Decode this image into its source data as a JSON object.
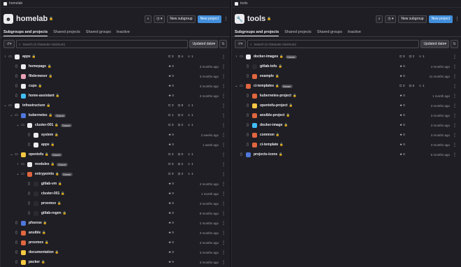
{
  "left": {
    "browser_tab": "homelab",
    "title": "homelab",
    "avatar_glyph": "☻",
    "actions": {
      "new_subgroup": "New subgroup",
      "new_project": "New project"
    },
    "tabs": [
      "Subgroups and projects",
      "Shared projects",
      "Shared groups",
      "Inactive"
    ],
    "search_placeholder": "Search (3 character minimum)",
    "sort_label": "Updated date",
    "rows": [
      {
        "indent": 0,
        "chev": "›",
        "kind": "group",
        "name": "apps",
        "icon_color": "#ececef",
        "stats": [
          "3",
          "4",
          "1"
        ],
        "time": ""
      },
      {
        "indent": 1,
        "chev": "",
        "kind": "project",
        "name": "homepage",
        "icon_color": "#ececef",
        "star": "0",
        "time": "3 months ago"
      },
      {
        "indent": 1,
        "chev": "",
        "kind": "project",
        "name": "filebrowser",
        "icon_color": "#e9a0b6",
        "star": "0",
        "time": "3 months ago"
      },
      {
        "indent": 1,
        "chev": "",
        "kind": "project",
        "name": "cups",
        "icon_color": "#ececef",
        "star": "0",
        "time": "3 months ago"
      },
      {
        "indent": 1,
        "chev": "",
        "kind": "project",
        "name": "home-assistant",
        "icon_color": "#41bdf5",
        "star": "0",
        "time": "3 months ago"
      },
      {
        "indent": 0,
        "chev": "⌄",
        "kind": "group",
        "name": "infrastructure",
        "icon_color": "#ececef",
        "stats": [
          "3",
          "8",
          "1"
        ],
        "time": ""
      },
      {
        "indent": 1,
        "chev": "⌄",
        "kind": "group",
        "name": "kubernetes",
        "badge": "Owner",
        "icon_color": "#4f77dc",
        "stats": [
          "1",
          "2",
          "1"
        ],
        "time": ""
      },
      {
        "indent": 2,
        "chev": "⌄",
        "kind": "group",
        "name": "cluster-001",
        "badge": "Owner",
        "icon_color": "#ececef",
        "stats": [
          "0",
          "2",
          "1"
        ],
        "time": ""
      },
      {
        "indent": 3,
        "chev": "",
        "kind": "project",
        "name": "system",
        "icon_color": "#ececef",
        "star": "0",
        "time": "2 weeks ago"
      },
      {
        "indent": 3,
        "chev": "",
        "kind": "project",
        "name": "apps",
        "icon_color": "#ececef",
        "star": "0",
        "time": "1 week ago"
      },
      {
        "indent": 1,
        "chev": "⌄",
        "kind": "group",
        "name": "opentofu",
        "badge": "Owner",
        "icon_color": "#f5c842",
        "stats": [
          "2",
          "0",
          "1"
        ],
        "time": ""
      },
      {
        "indent": 2,
        "chev": "›",
        "kind": "group",
        "name": "modules",
        "badge": "Owner",
        "icon_color": "#ececef",
        "stats": [
          "0",
          "2",
          "1"
        ],
        "time": ""
      },
      {
        "indent": 2,
        "chev": "⌄",
        "kind": "group",
        "name": "entrypoints",
        "badge": "Owner",
        "icon_color": "#e0663f",
        "stats": [
          "0",
          "4",
          "1"
        ],
        "time": ""
      },
      {
        "indent": 3,
        "chev": "",
        "kind": "project",
        "name": "gitlab-vm",
        "icon_color": "#2b2a30",
        "star": "0",
        "time": "3 months ago"
      },
      {
        "indent": 3,
        "chev": "",
        "kind": "project",
        "name": "cluster-001",
        "icon_color": "#2b2a30",
        "star": "0",
        "time": "1 month ago"
      },
      {
        "indent": 3,
        "chev": "",
        "kind": "project",
        "name": "proxmox",
        "icon_color": "#2b2a30",
        "star": "0",
        "time": "3 months ago"
      },
      {
        "indent": 3,
        "chev": "",
        "kind": "project",
        "name": "gitlab-regen",
        "icon_color": "#2b2a30",
        "star": "0",
        "time": "8 months ago"
      },
      {
        "indent": 1,
        "chev": "",
        "kind": "project",
        "name": "pfsense",
        "icon_color": "#4f77dc",
        "star": "0",
        "time": "2 months ago"
      },
      {
        "indent": 1,
        "chev": "",
        "kind": "project",
        "name": "ansible",
        "icon_color": "#e0663f",
        "star": "0",
        "time": "3 months ago"
      },
      {
        "indent": 1,
        "chev": "",
        "kind": "project",
        "name": "proxmox",
        "icon_color": "#e0663f",
        "star": "0",
        "time": "3 months ago"
      },
      {
        "indent": 1,
        "chev": "",
        "kind": "project",
        "name": "documentation",
        "icon_color": "#f5c842",
        "star": "0",
        "time": "3 months ago"
      },
      {
        "indent": 1,
        "chev": "",
        "kind": "project",
        "name": "packer",
        "icon_color": "#f5c842",
        "star": "0",
        "time": "3 months ago"
      }
    ]
  },
  "right": {
    "browser_tab": "tools",
    "title": "tools",
    "avatar_glyph": "🔧",
    "actions": {
      "new_subgroup": "New subgroup",
      "new_project": "New project"
    },
    "tabs": [
      "Subgroups and projects",
      "Shared projects",
      "Shared groups",
      "Inactive"
    ],
    "search_placeholder": "Search (3 character minimum)",
    "sort_label": "Updated date",
    "rows": [
      {
        "indent": 0,
        "chev": "›",
        "kind": "group",
        "name": "docker-images",
        "badge": "Owner",
        "icon_color": "#ececef",
        "stats": [
          "0",
          "2",
          "1"
        ],
        "time": ""
      },
      {
        "indent": 1,
        "chev": "",
        "kind": "project",
        "name": "gitlab-tofu",
        "icon_color": "#2b2a30",
        "star": "0",
        "time": "4 months ago"
      },
      {
        "indent": 1,
        "chev": "",
        "kind": "project",
        "name": "example",
        "icon_color": "#e0663f",
        "star": "0",
        "time": "11 months ago"
      },
      {
        "indent": 0,
        "chev": "⌄",
        "kind": "group",
        "name": "ci-templates",
        "badge": "Owner",
        "icon_color": "#e0663f",
        "stats": [
          "0",
          "6",
          "1"
        ],
        "time": ""
      },
      {
        "indent": 1,
        "chev": "",
        "kind": "project",
        "name": "kubernetes-project",
        "icon_color": "#e0663f",
        "star": "0",
        "time": "1 month ago"
      },
      {
        "indent": 1,
        "chev": "",
        "kind": "project",
        "name": "opentofu-project",
        "icon_color": "#f5c842",
        "star": "0",
        "time": "3 months ago"
      },
      {
        "indent": 1,
        "chev": "",
        "kind": "project",
        "name": "ansible-project",
        "icon_color": "#e0663f",
        "star": "0",
        "time": "3 months ago"
      },
      {
        "indent": 1,
        "chev": "",
        "kind": "project",
        "name": "docker-image",
        "icon_color": "#41bdf5",
        "star": "0",
        "time": "3 months ago"
      },
      {
        "indent": 1,
        "chev": "",
        "kind": "project",
        "name": "common",
        "icon_color": "#e0663f",
        "star": "0",
        "time": "3 months ago"
      },
      {
        "indent": 1,
        "chev": "",
        "kind": "project",
        "name": "ci-template",
        "icon_color": "#e0663f",
        "star": "0",
        "time": "3 months ago"
      },
      {
        "indent": 0,
        "chev": "",
        "kind": "project",
        "name": "projects-icons",
        "icon_color": "#4f77dc",
        "star": "0",
        "time": "5 months ago"
      }
    ]
  }
}
